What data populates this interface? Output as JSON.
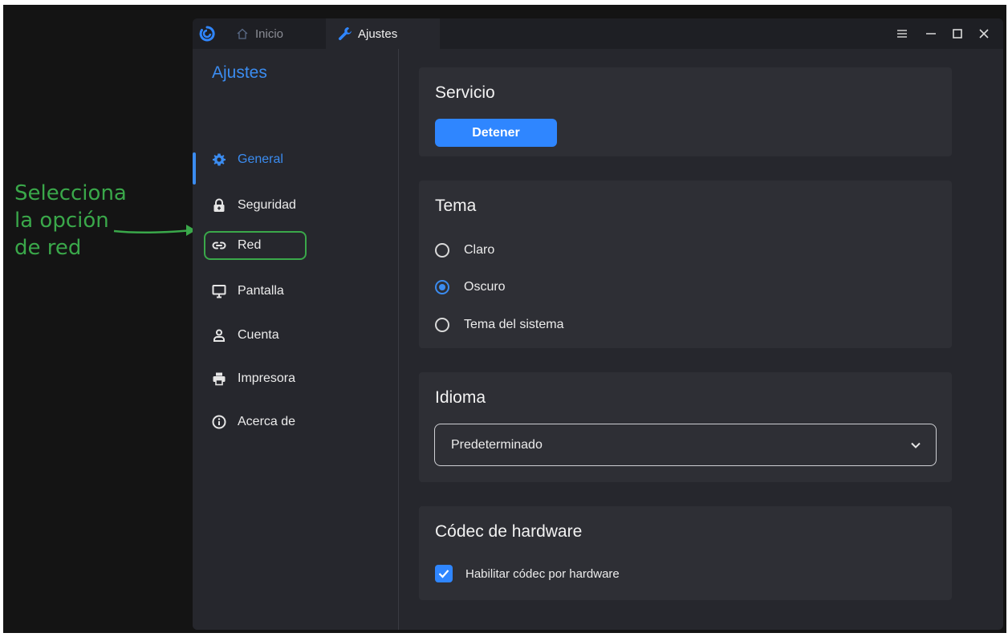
{
  "annotation": {
    "text": "Selecciona\nla opción\nde red",
    "color": "#3aa84a"
  },
  "titlebar": {
    "tabs": [
      {
        "label": "Inicio",
        "icon": "home-icon"
      },
      {
        "label": "Ajustes",
        "icon": "wrench-icon"
      }
    ],
    "controls": [
      "menu-icon",
      "minimize-icon",
      "maximize-icon",
      "close-icon"
    ]
  },
  "sidebar": {
    "title": "Ajustes",
    "items": [
      {
        "label": "General",
        "icon": "gear-icon",
        "active": true
      },
      {
        "label": "Seguridad",
        "icon": "lock-icon"
      },
      {
        "label": "Red",
        "icon": "link-icon",
        "highlighted": true
      },
      {
        "label": "Pantalla",
        "icon": "monitor-icon"
      },
      {
        "label": "Cuenta",
        "icon": "user-icon"
      },
      {
        "label": "Impresora",
        "icon": "printer-icon"
      },
      {
        "label": "Acerca de",
        "icon": "info-icon"
      }
    ]
  },
  "main": {
    "servicio": {
      "title": "Servicio",
      "button_label": "Detener"
    },
    "tema": {
      "title": "Tema",
      "options": [
        {
          "label": "Claro",
          "selected": false
        },
        {
          "label": "Oscuro",
          "selected": true
        },
        {
          "label": "Tema del sistema",
          "selected": false
        }
      ]
    },
    "idioma": {
      "title": "Idioma",
      "selected": "Predeterminado"
    },
    "codec": {
      "title": "Códec de hardware",
      "checkbox_label": "Habilitar códec por hardware",
      "checked": true
    }
  },
  "colors": {
    "accent": "#3b8cf0",
    "button": "#2f86ff",
    "background": "#26272d",
    "card": "#2e2f35"
  }
}
